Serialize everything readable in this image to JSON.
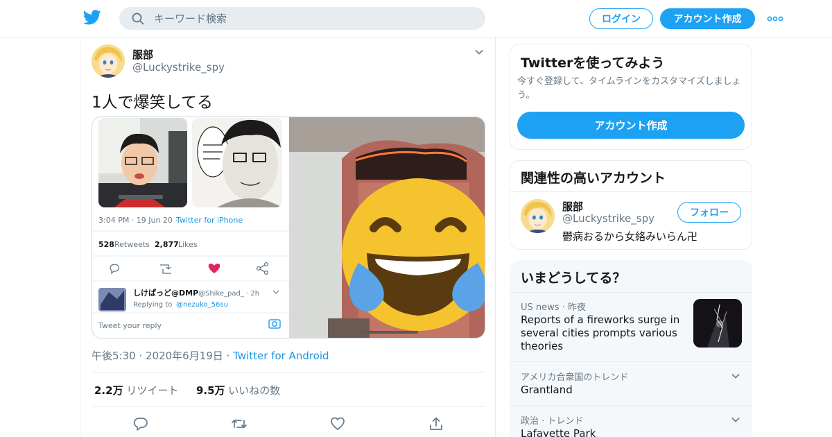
{
  "header": {
    "search_placeholder": "キーワード検索",
    "login_label": "ログイン",
    "signup_label": "アカウント作成"
  },
  "tweet": {
    "name": "服部",
    "handle": "@Luckystrike_spy",
    "text": "1人で爆笑してる",
    "time": "午後5:30",
    "date": "2020年6月19日",
    "source": "Twitter for Android",
    "retweets_count": "2.2万",
    "retweets_label": "リツイート",
    "likes_count": "9.5万",
    "likes_label": "いいねの数",
    "media": {
      "time_line": "3:04 PM · 19 Jun 20 · ",
      "via": "Twitter for iPhone",
      "retweets_count": "528",
      "retweets_label": "Retweets",
      "likes_count": "2,877",
      "likes_label": "Likes",
      "reply_name": "しけぱっど@DMP",
      "reply_handle": "@Shike_pad_ · 2h",
      "replying_to_label": "Replying to",
      "replying_to_handle": "@nezuko_56su",
      "reply_placeholder": "Tweet your reply"
    }
  },
  "sidebar": {
    "signup_card": {
      "title": "Twitterを使ってみよう",
      "subtitle": "今すぐ登録して、タイムラインをカスタマイズしましょう。",
      "button": "アカウント作成"
    },
    "related_card": {
      "title": "関連性の高いアカウント",
      "name": "服部",
      "handle": "@Luckystrike_spy",
      "bio": "鬱病おるから女絡みいらん卍",
      "follow_label": "フォロー"
    },
    "trends_card": {
      "title": "いまどうしてる？",
      "items": [
        {
          "meta": "US news · 昨夜",
          "title": "Reports of a fireworks surge in several cities prompts various theories"
        },
        {
          "meta": "アメリカ合衆国のトレンド",
          "title": "Grantland"
        },
        {
          "meta": "政治 · トレンド",
          "title": "Lafayette Park"
        }
      ]
    }
  },
  "colors": {
    "accent": "#1da1f2",
    "link": "#1b95e0",
    "secondary_text": "#657786",
    "border": "#e6ecf0",
    "like_red": "#e0245e"
  }
}
